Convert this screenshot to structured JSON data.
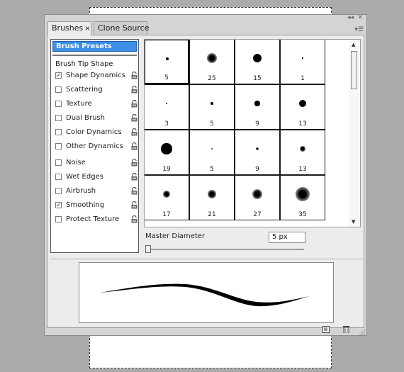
{
  "tabs": [
    {
      "label": "Brushes",
      "active": true
    },
    {
      "label": "Clone Source",
      "active": false
    }
  ],
  "tab_close_glyph": "×",
  "left_panel": {
    "header": "Brush Presets",
    "tip_shape": "Brush Tip Shape",
    "items": [
      {
        "label": "Shape Dynamics",
        "checked": true,
        "lock": true
      },
      {
        "label": "Scattering",
        "checked": false,
        "lock": true
      },
      {
        "label": "Texture",
        "checked": false,
        "lock": true
      },
      {
        "label": "Dual Brush",
        "checked": false,
        "lock": true
      },
      {
        "label": "Color Dynamics",
        "checked": false,
        "lock": true
      },
      {
        "label": "Other Dynamics",
        "checked": false,
        "lock": true
      },
      {
        "label": "Noise",
        "checked": false,
        "lock": true
      },
      {
        "label": "Wet Edges",
        "checked": false,
        "lock": true
      },
      {
        "label": "Airbrush",
        "checked": false,
        "lock": true
      },
      {
        "label": "Smoothing",
        "checked": true,
        "lock": true
      },
      {
        "label": "Protect Texture",
        "checked": false,
        "lock": true
      }
    ]
  },
  "brushes": [
    {
      "size": "5",
      "style": "hard",
      "selected": true
    },
    {
      "size": "25",
      "style": "soft"
    },
    {
      "size": "15",
      "style": "hard"
    },
    {
      "size": "1",
      "style": "hard"
    },
    {
      "size": "3",
      "style": "hard"
    },
    {
      "size": "5",
      "style": "hard"
    },
    {
      "size": "9",
      "style": "hard"
    },
    {
      "size": "13",
      "style": "hard"
    },
    {
      "size": "19",
      "style": "hard"
    },
    {
      "size": "5",
      "style": "soft"
    },
    {
      "size": "9",
      "style": "soft"
    },
    {
      "size": "13",
      "style": "soft"
    },
    {
      "size": "17",
      "style": "soft"
    },
    {
      "size": "21",
      "style": "soft"
    },
    {
      "size": "27",
      "style": "soft"
    },
    {
      "size": "35",
      "style": "soft"
    }
  ],
  "master_diameter": {
    "label": "Master Diameter",
    "value": "5 px"
  },
  "icons": {
    "panel_menu": "menu-icon",
    "collapse": "collapse-icon",
    "close": "close-icon",
    "new_brush": "new-brush-icon",
    "delete": "trash-icon"
  },
  "colors": {
    "header_blue": "#3d8fe6",
    "panel_bg": "#ececec"
  }
}
